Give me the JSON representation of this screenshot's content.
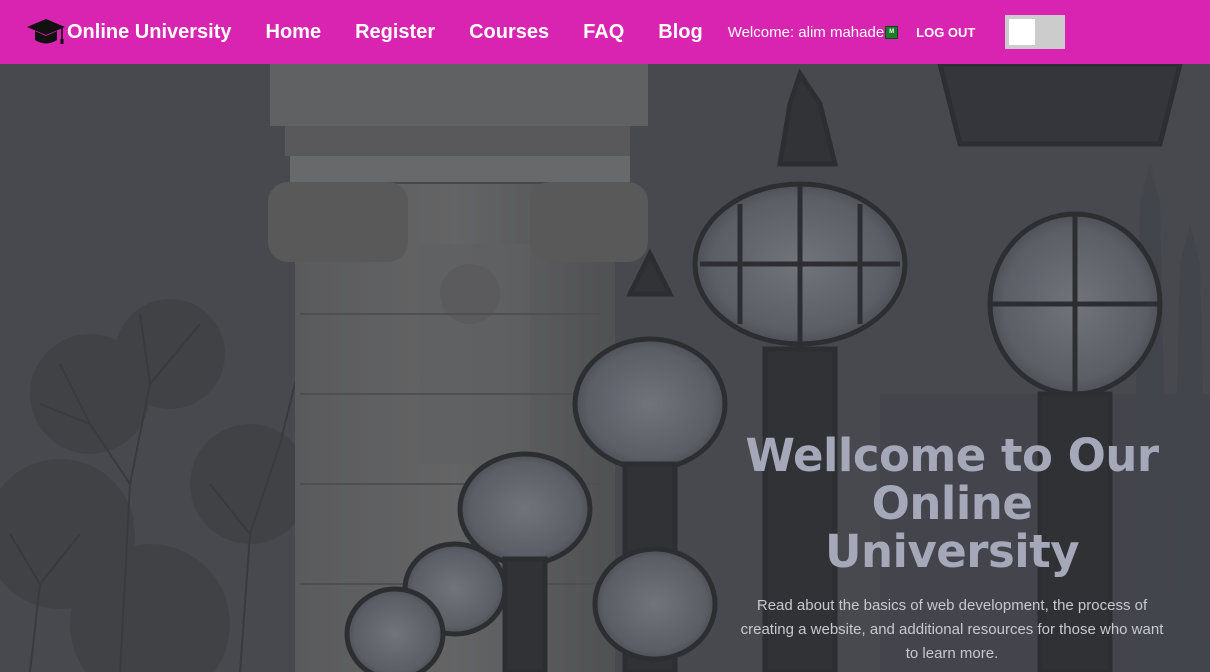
{
  "navbar": {
    "brand": {
      "icon": "graduation-cap-icon",
      "text": "Online University"
    },
    "links": [
      "Home",
      "Register",
      "Courses",
      "FAQ",
      "Blog"
    ],
    "welcome": "Welcome: alim mahade",
    "avatar_letter": "M",
    "logout_label": "LOG OUT",
    "theme_toggle": {
      "state": "off"
    },
    "colors": {
      "background": "#d924b1",
      "text": "#ffffff"
    }
  },
  "hero": {
    "title_line1": "Wellcome to Our",
    "title_line2": "Online University",
    "description": "Read about the basics of web development, the process of creating a website, and additional resources for those who want to learn more.",
    "colors": {
      "title": "#a4a8b8",
      "text": "#c8c9cf",
      "overlay": "#4a4b50"
    }
  }
}
